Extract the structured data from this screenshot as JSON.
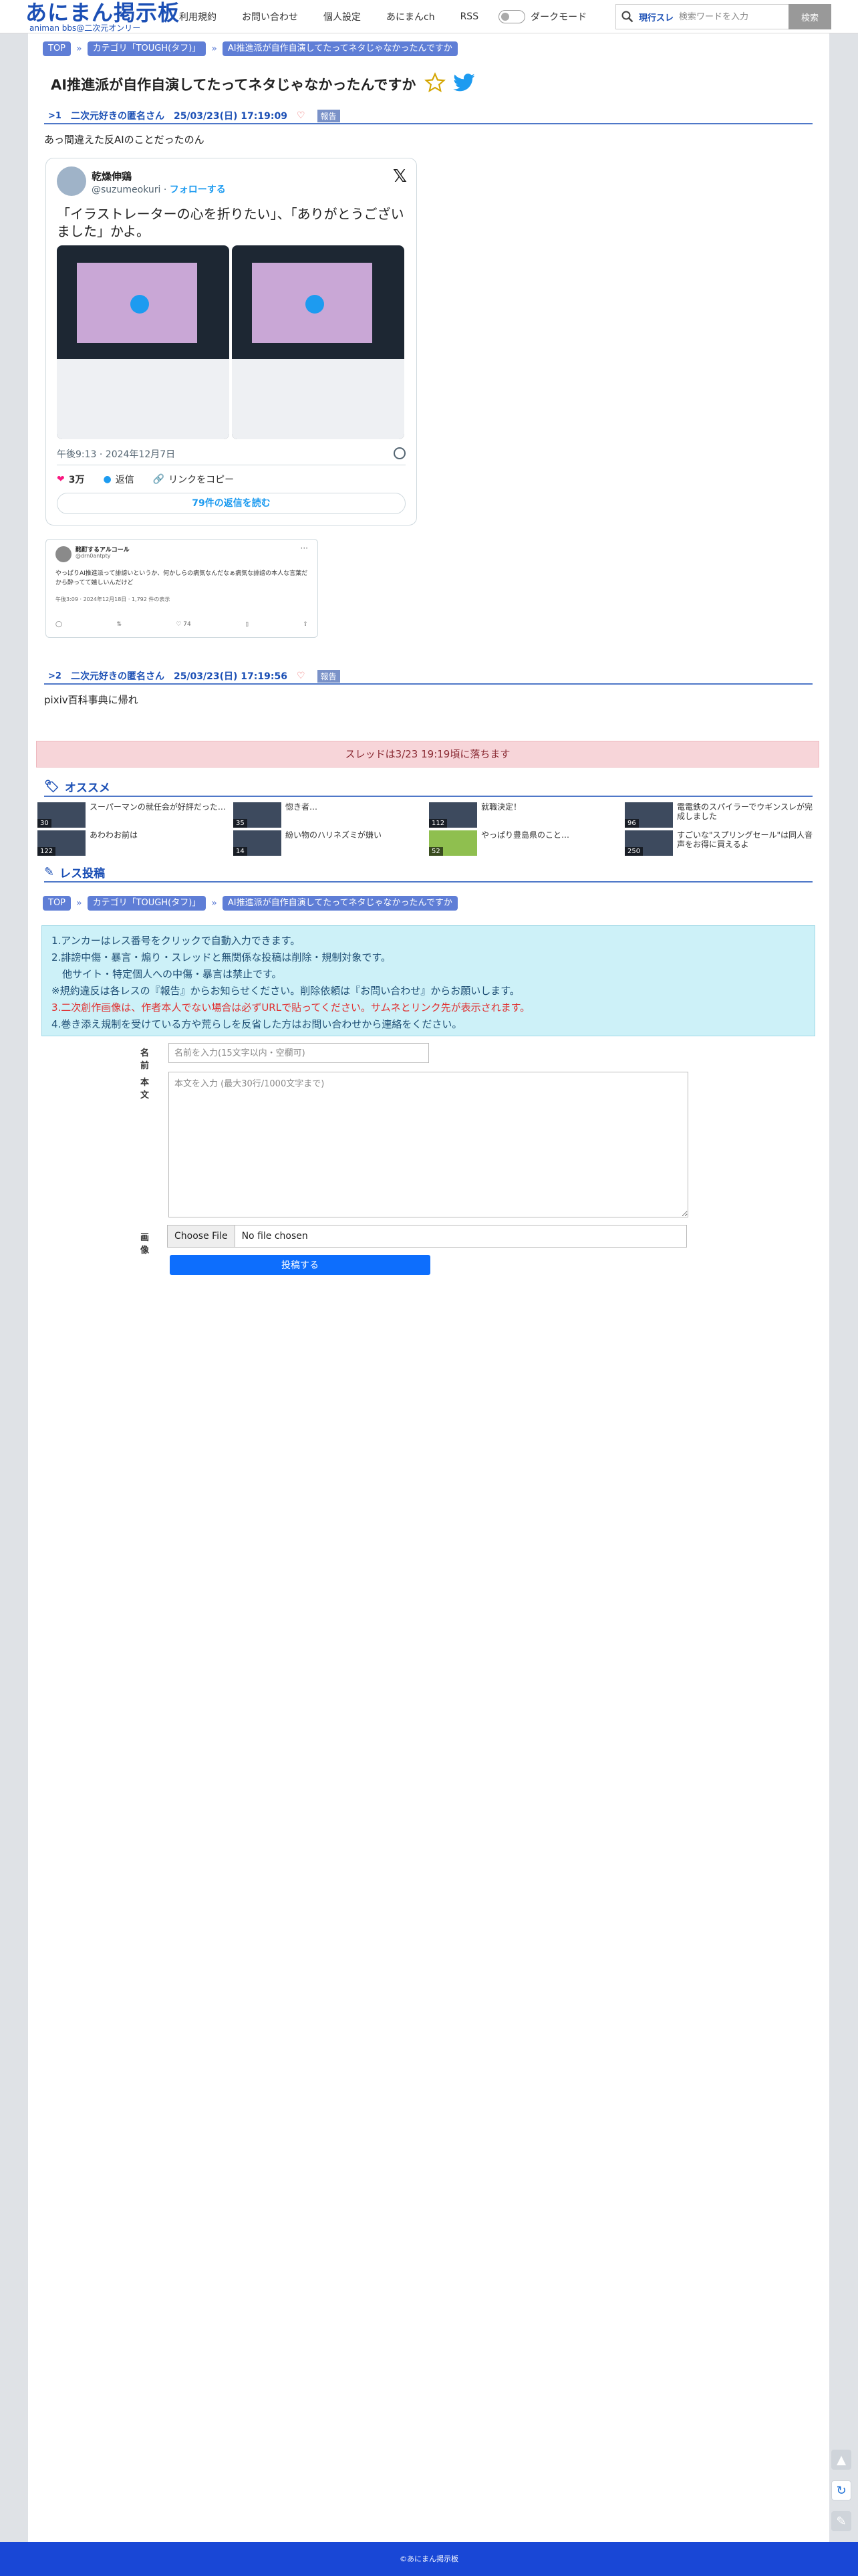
{
  "header": {
    "logo_main": "あにまん掲示板",
    "logo_sub": "animan bbs@二次元オンリー",
    "nav": [
      "利用規約",
      "お問い合わせ",
      "個人設定",
      "あにまんch",
      "RSS"
    ],
    "dark_mode_label": "ダークモード",
    "search": {
      "scope": "現行スレ",
      "placeholder": "検索ワードを入力",
      "button": "検索"
    }
  },
  "breadcrumb": {
    "top": "TOP",
    "category": "カテゴリ「TOUGH(タフ)」",
    "thread": "AI推進派が自作自演してたってネタじゃなかったんですか"
  },
  "thread": {
    "title": "AI推進派が自作自演してたってネタじゃなかったんですか"
  },
  "posts": [
    {
      "num": ">1",
      "name": "二次元好きの匿名さん",
      "date": "25/03/23(日) 17:19:09",
      "report": "報告",
      "body": "あっ間違えた反AIのことだったのん"
    },
    {
      "num": ">2",
      "name": "二次元好きの匿名さん",
      "date": "25/03/23(日) 17:19:56",
      "report": "報告",
      "body": "pixiv百科事典に帰れ"
    }
  ],
  "embed": {
    "name": "乾燥伸鶏",
    "handle": "@suzumeokuri",
    "follow": "フォローする",
    "text": "「イラストレーターの心を折りたい」、「ありがとうございました」かよ。",
    "time": "午後9:13 · 2024年12月7日",
    "likes": "3万",
    "reply": "返信",
    "copy": "リンクをコピー",
    "more_replies": "79件の返信を読む"
  },
  "embed2": {
    "name": "酩酊するアルコール",
    "handle": "@drn0antpty",
    "text": "やっぱりAI推進派って誹謗いというか、何かしらの病気なんだなぁ病気な誹謗の本人な言葉だから酔ってて嬉しいんだけど",
    "date": "午後3:09 · 2024年12月18日 · 1,792 件の表示",
    "likes": "74"
  },
  "fall_notice": "スレッドは3/23 19:19頃に落ちます",
  "recommend": {
    "heading": "オススメ",
    "items": [
      {
        "title": "スーパーマンの就任会が好評だった…",
        "count": "30"
      },
      {
        "title": "惚き者…",
        "count": "35"
      },
      {
        "title": "就職決定！",
        "count": "112"
      },
      {
        "title": "電電鉄のスパイラーでウギンスレが完成しました",
        "count": "96"
      },
      {
        "title": "あわわお前は",
        "count": "122"
      },
      {
        "title": "紛い物のハリネズミが嫌い",
        "count": "14"
      },
      {
        "title": "やっぱり豊島県のこと…",
        "count": "52"
      },
      {
        "title": "すごいな\"スプリングセール\"は同人音声をお得に買えるよ",
        "count": "250"
      }
    ]
  },
  "post_form": {
    "heading": "レス投稿",
    "rules": [
      "1.アンカーはレス番号をクリックで自動入力できます。",
      "2.誹謗中傷・暴言・煽り・スレッドと無関係な投稿は削除・規制対象です。",
      "他サイト・特定個人への中傷・暴言は禁止です。",
      "※規約違反は各レスの『報告』からお知らせください。削除依頼は『お問い合わせ』からお願いします。",
      "3.二次創作画像は、作者本人でない場合は必ずURLで貼ってください。サムネとリンク先が表示されます。",
      "4.巻き添え規制を受けている方や荒らしを反省した方はお問い合わせから連絡をください。"
    ],
    "name_label": "名前",
    "name_placeholder": "名前を入力(15文字以内・空欄可)",
    "body_label": "本文",
    "body_placeholder": "本文を入力 (最大30行/1000文字まで)",
    "image_label": "画像",
    "file_button": "Choose File",
    "file_status": "No file chosen",
    "submit": "投稿する"
  },
  "footer": "©あにまん掲示板",
  "colors": {
    "brand": "#1b4fb5",
    "crumb": "#5f7ed6",
    "notice": "#f7d5d9",
    "rules_bg": "#cdf1f8",
    "submit": "#0d6efd",
    "footer": "#1947d6"
  }
}
